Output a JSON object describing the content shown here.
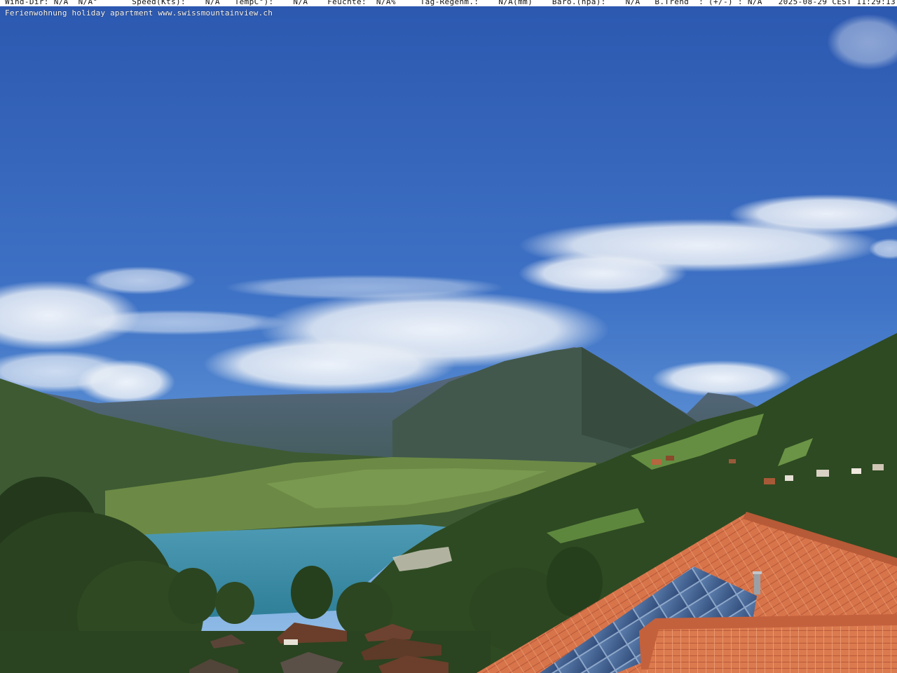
{
  "overlay": {
    "weather_line": "Wind-Dir: N/A  N/A°       Speed(Kts):    N/A   TempC°):    N/A    Feuchte:  N/A%     Tag-Regenm.:    N/A(mm)    Baro.(hpa):    N/A   B.Trend  : (+/-) : N/A",
    "timestamp": "2025-08-29 CEST 11:29:13",
    "caption": "Ferienwohnung holiday apartment www.swissmountainview.ch"
  },
  "colors": {
    "sky_top": "#2f5fb8",
    "sky_bottom": "#7aa9df",
    "lake": "#3f8fa8",
    "roof": "#d9734a",
    "forest": "#2f4a22"
  }
}
